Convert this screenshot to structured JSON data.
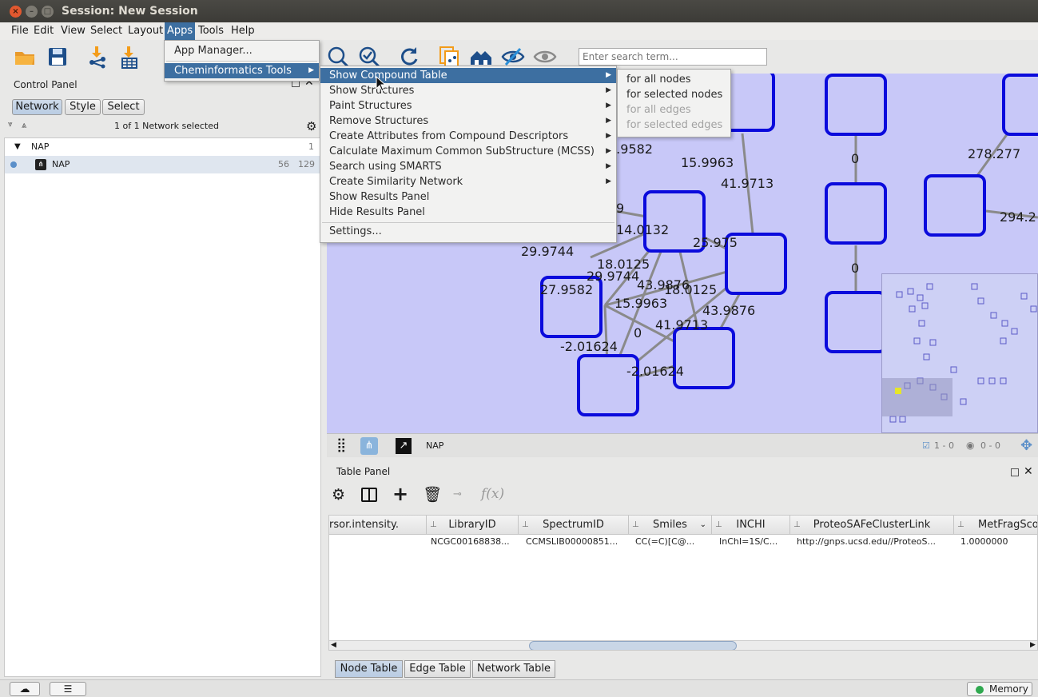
{
  "window": {
    "title": "Session: New Session"
  },
  "menubar": {
    "items": [
      "File",
      "Edit",
      "View",
      "Select",
      "Layout",
      "Apps",
      "Tools",
      "Help"
    ]
  },
  "apps_menu": {
    "items": [
      "App Manager...",
      "Cheminformatics Tools"
    ]
  },
  "chem_menu": {
    "items": [
      "Show Compound Table",
      "Show Structures",
      "Paint Structures",
      "Remove Structures",
      "Create Attributes from Compound Descriptors",
      "Calculate Maximum Common SubStructure (MCSS)",
      "Search using SMARTS",
      "Create Similarity Network",
      "Show Results Panel",
      "Hide Results Panel",
      "Settings..."
    ]
  },
  "compound_submenu": {
    "items": [
      "for all nodes",
      "for selected nodes",
      "for all edges",
      "for selected edges"
    ],
    "disabled": [
      "for all edges",
      "for selected edges"
    ]
  },
  "toolbar": {
    "search_placeholder": "Enter search term..."
  },
  "control_panel": {
    "title": "Control Panel",
    "tabs": [
      "Network",
      "Style",
      "Select"
    ],
    "selection_status": "1 of 1 Network selected",
    "tree": {
      "collection": {
        "name": "NAP",
        "count": "1"
      },
      "network": {
        "name": "NAP",
        "nodes": "56",
        "edges": "129"
      }
    }
  },
  "network_view": {
    "edge_labels": [
      "7.9582",
      "15.9963",
      "41.9713",
      "0",
      "0",
      "278.277",
      "294.2",
      "9",
      "14.0132",
      "25.975",
      "29.9744",
      "18.0125",
      "29.9744",
      "43.9876",
      "18.0125",
      "27.9582",
      "15.9963",
      "43.9876",
      "0",
      "41.9713",
      "-2.01624",
      "-2.01624"
    ],
    "bar": {
      "name": "NAP",
      "selected_counts": "1 - 0",
      "hidden_counts": "0 - 0"
    }
  },
  "table_panel": {
    "title": "Table Panel",
    "columns": [
      "rsor.intensity.",
      "LibraryID",
      "SpectrumID",
      "Smiles",
      "INCHI",
      "ProteoSAFeClusterLink",
      "MetFragSco"
    ],
    "row": [
      "",
      "NCGC00168838...",
      "CCMSLIB00000851...",
      "CC(=C)[C@...",
      "InChI=1S/C...",
      "http://gnps.ucsd.edu//ProteoS...",
      "1.0000000"
    ],
    "tabs": [
      "Node Table",
      "Edge Table",
      "Network Table"
    ]
  },
  "statusbar": {
    "memory_label": "Memory"
  },
  "colors": {
    "accent": "#3d6fa1",
    "node_border": "#0b0bdc",
    "canvas": "#c8c8f8"
  }
}
